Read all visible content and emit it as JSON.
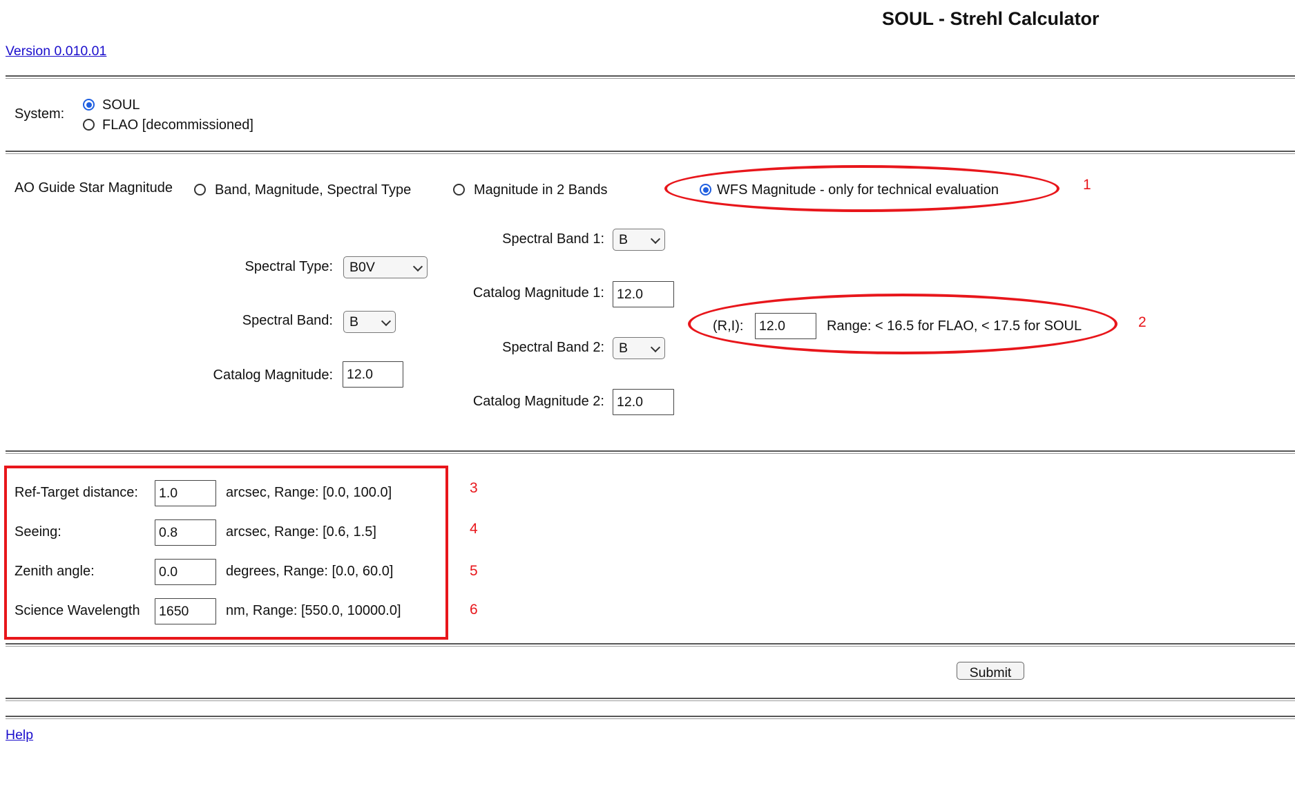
{
  "header": {
    "title": "SOUL - Strehl Calculator",
    "version_link": "Version 0.010.01"
  },
  "system": {
    "label": "System:",
    "options": [
      {
        "label": "SOUL",
        "checked": true
      },
      {
        "label": "FLAO [decommissioned]",
        "checked": false
      }
    ]
  },
  "ao": {
    "label": "AO Guide Star Magnitude",
    "modes": [
      {
        "label": "Band, Magnitude, Spectral Type",
        "checked": false
      },
      {
        "label": "Magnitude in 2 Bands",
        "checked": false
      },
      {
        "label": "WFS Magnitude - only for technical evaluation",
        "checked": true
      }
    ],
    "col1": {
      "spectral_type_label": "Spectral Type:",
      "spectral_type_value": "B0V",
      "spectral_band_label": "Spectral Band:",
      "spectral_band_value": "B",
      "catalog_mag_label": "Catalog Magnitude:",
      "catalog_mag_value": "12.0"
    },
    "col2": {
      "band1_label": "Spectral Band 1:",
      "band1_value": "B",
      "mag1_label": "Catalog Magnitude 1:",
      "mag1_value": "12.0",
      "band2_label": "Spectral Band 2:",
      "band2_value": "B",
      "mag2_label": "Catalog Magnitude 2:",
      "mag2_value": "12.0"
    },
    "col3": {
      "ri_label": "(R,I):",
      "ri_value": "12.0",
      "range_text": "Range: < 16.5 for FLAO, < 17.5 for SOUL"
    }
  },
  "params": [
    {
      "label": "Ref-Target distance:",
      "value": "1.0",
      "range": "arcsec, Range: [0.0, 100.0]"
    },
    {
      "label": "Seeing:",
      "value": "0.8",
      "range": "arcsec, Range: [0.6, 1.5]"
    },
    {
      "label": "Zenith angle:",
      "value": "0.0",
      "range": "degrees, Range: [0.0, 60.0]"
    },
    {
      "label": "Science Wavelength",
      "value": "1650",
      "range": "nm, Range: [550.0, 10000.0]"
    }
  ],
  "annotations": [
    "1",
    "2",
    "3",
    "4",
    "5",
    "6"
  ],
  "annotation_color": "#e8161b",
  "submit_label": "Submit",
  "help_link": "Help"
}
